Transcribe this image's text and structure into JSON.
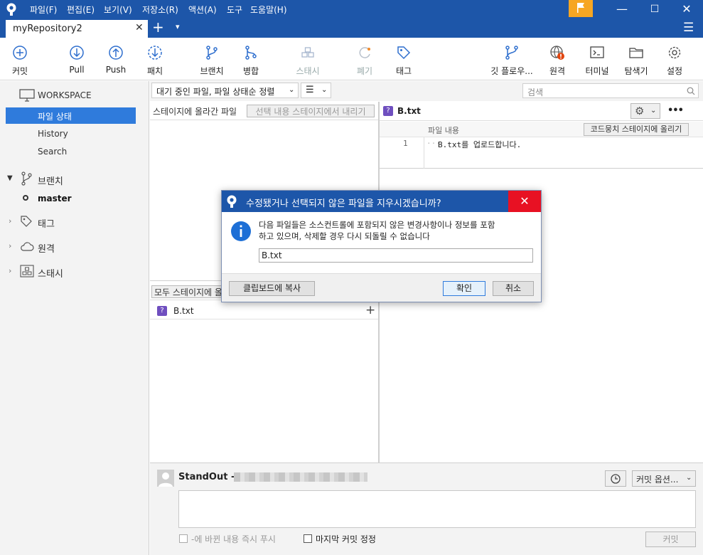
{
  "titlebar": {
    "menus": [
      "파일(F)",
      "편집(E)",
      "보기(V)",
      "저장소(R)",
      "액션(A)",
      "도구",
      "도움말(H)"
    ],
    "minimize": "—",
    "maximize": "☐",
    "close": "✕",
    "accent": "#1d56a9",
    "flag_color": "#f6a623"
  },
  "tabs": {
    "active_tab": "myRepository2",
    "close": "✕",
    "new_tab": "+",
    "dropdown": "▾",
    "menu": "☰"
  },
  "toolbar": {
    "commit": "커밋",
    "pull": "Pull",
    "push": "Push",
    "fetch": "패치",
    "branch": "브랜치",
    "merge": "병합",
    "stash": "스태시",
    "discard": "폐기",
    "tag": "태그",
    "git_flow": "깃 플로우...",
    "remote": "원격",
    "terminal": "터미널",
    "explorer": "탐색기",
    "settings": "설정"
  },
  "sidebar": {
    "workspace": "WORKSPACE",
    "file_status": "파일 상태",
    "history": "History",
    "search": "Search",
    "branches": "브랜치",
    "current_branch": "master",
    "tags": "태그",
    "remotes": "원격",
    "stashes": "스태시"
  },
  "filter": {
    "sort_dropdown": "대기 중인 파일, 파일 상태순 정렬",
    "view_dropdown": "☰",
    "search_placeholder": "검색"
  },
  "staged": {
    "header": "스테이지에 올라간 파일",
    "unstage_selected": "선택 내용 스테이지에서 내리기"
  },
  "unstaged": {
    "stage_all": "모두 스테이지에 올리기",
    "files": [
      {
        "badge": "?",
        "name": "B.txt",
        "action": "+"
      }
    ]
  },
  "diff": {
    "file_badge": "?",
    "file_name": "B.txt",
    "gear": "⚙",
    "more": "•••",
    "hunk_header": "파일 내용",
    "stage_hunk": "코드뭉치 스테이지에 올리기",
    "lines": [
      {
        "num": "1",
        "text": "B.txt를 업로드합니다."
      }
    ]
  },
  "commit_area": {
    "author": "StandOut -",
    "options": "커밋 옵션...",
    "push_immediately": "-에 바뀐 내용 즉시 푸시",
    "amend": "마지막 커밋 정정",
    "commit_button": "커밋"
  },
  "dialog": {
    "title": "수정됐거나 선택되지 않은 파일을 지우시겠습니까?",
    "close": "✕",
    "message_line1": "다음 파일들은 소스컨트롤에 포함되지 않은 변경사항이나 정보를 포함",
    "message_line2": "하고 있으며, 삭제할 경우 다시 되돌릴 수 없습니다",
    "file": "B.txt",
    "copy": "클립보드에 복사",
    "ok": "확인",
    "cancel": "취소"
  }
}
